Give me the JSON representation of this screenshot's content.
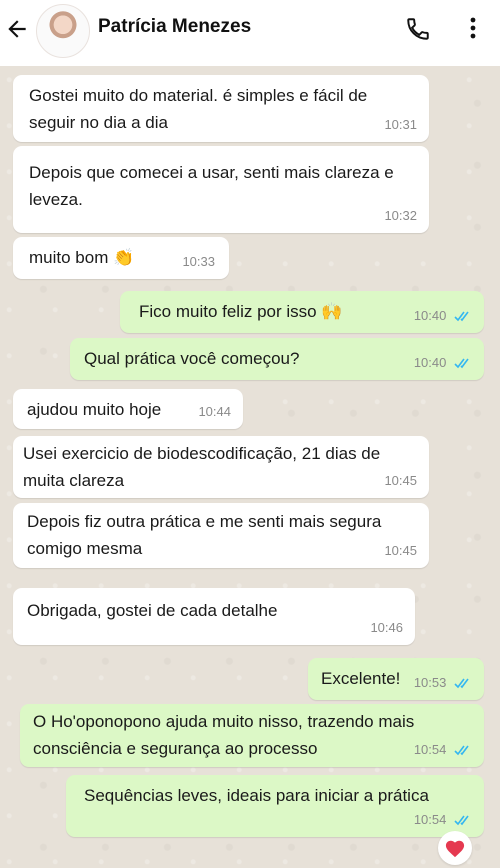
{
  "contact": {
    "name": "Patrícia Menezes",
    "avatar": "contact-photo"
  },
  "icons": {
    "back": "arrow-back-icon",
    "call": "phone-icon",
    "menu": "more-vertical-icon",
    "read": "double-check-icon",
    "reaction": "heart-icon"
  },
  "colors": {
    "incoming": "#ffffff",
    "outgoing": "#dcf8c6",
    "read_ticks": "#34b7f1",
    "heart": "#e53950"
  },
  "messages": [
    {
      "dir": "in",
      "text": "Gostei muito do material. é simples e fácil de seguir no dia a dia",
      "time": "10:31"
    },
    {
      "dir": "in",
      "text": "Depois que comecei a usar, senti mais clareza e leveza.",
      "time": "10:32"
    },
    {
      "dir": "in",
      "text": "muito bom 👏",
      "time": "10:33"
    },
    {
      "dir": "out",
      "text": "Fico muito feliz por isso 🙌",
      "time": "10:40",
      "read": true
    },
    {
      "dir": "out",
      "text": "Qual prática você começou?",
      "time": "10:40",
      "read": true
    },
    {
      "dir": "in",
      "text": "ajudou muito hoje",
      "time": "10:44"
    },
    {
      "dir": "in",
      "text": "Usei exercicio de biodescodificação, 21 dias de muita clareza",
      "time": "10:45"
    },
    {
      "dir": "in",
      "text": "Depois fiz outra prática e me senti mais segura comigo mesma",
      "time": "10:45"
    },
    {
      "dir": "in",
      "text": "Obrigada, gostei de cada detalhe",
      "time": "10:46"
    },
    {
      "dir": "out",
      "text": "Excelente!",
      "time": "10:53",
      "read": true
    },
    {
      "dir": "out",
      "text": "O Ho'oponopono ajuda muito nisso, trazendo mais consciência e segurança ao processo",
      "time": "10:54",
      "read": true
    },
    {
      "dir": "out",
      "text": "Sequências leves, ideais para iniciar a prática",
      "time": "10:54",
      "read": true,
      "reaction": "❤️"
    }
  ]
}
